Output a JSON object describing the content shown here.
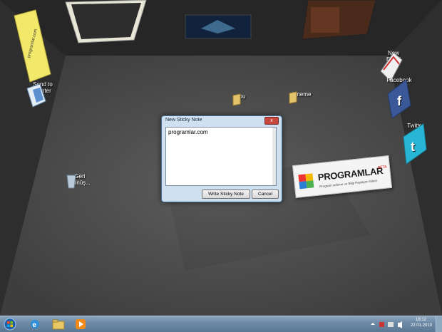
{
  "desktop": {
    "icons": [
      {
        "label": "Send to Printer"
      },
      {
        "label": "Geri Dönüş..."
      },
      {
        "label": "bu"
      },
      {
        "label": "deneme"
      },
      {
        "label": "New Email"
      },
      {
        "label": "Facebook"
      },
      {
        "label": "Twitter"
      }
    ],
    "yellow_note_text": "programlar.com",
    "banner": {
      "title": "PROGRAMLAR",
      "badge": "BETA",
      "subtitle": "Program indirme ve Bilgi Paylaşım Sitesi"
    }
  },
  "dialog": {
    "title": "New Sticky Note",
    "close_label": "x",
    "note_text": "programlar.com",
    "write_button": "Write Sticky Note",
    "cancel_button": "Cancel"
  },
  "taskbar": {
    "icons": [
      "start-orb-icon",
      "ie-icon",
      "explorer-icon",
      "media-player-icon"
    ],
    "clock_time": "18:12",
    "clock_date": "22.01.2010"
  },
  "colors": {
    "floor": "#4a4a4a",
    "wall": "#2b2b2b",
    "dialog_frame": "#cfe0f1",
    "taskbar": "#6d8aa6"
  }
}
